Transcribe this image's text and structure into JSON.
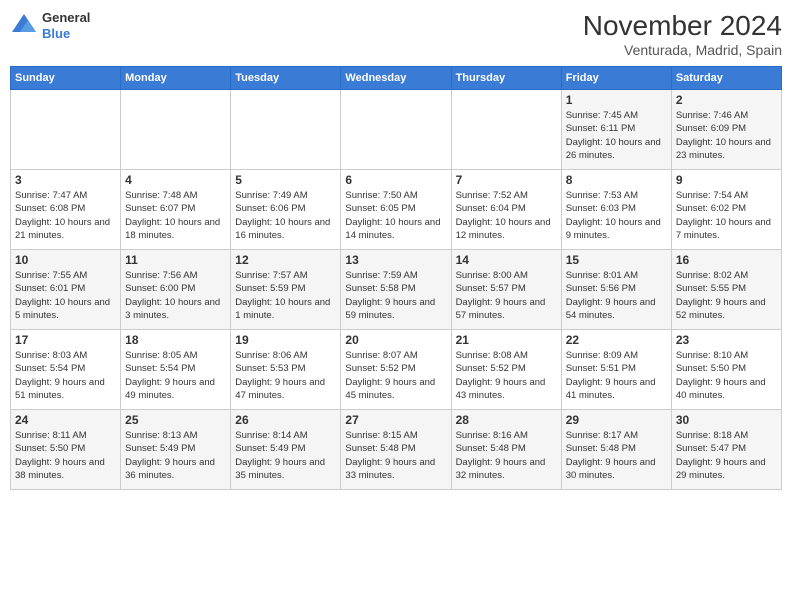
{
  "logo": {
    "general": "General",
    "blue": "Blue"
  },
  "title": "November 2024",
  "location": "Venturada, Madrid, Spain",
  "days_of_week": [
    "Sunday",
    "Monday",
    "Tuesday",
    "Wednesday",
    "Thursday",
    "Friday",
    "Saturday"
  ],
  "weeks": [
    [
      {
        "day": "",
        "info": ""
      },
      {
        "day": "",
        "info": ""
      },
      {
        "day": "",
        "info": ""
      },
      {
        "day": "",
        "info": ""
      },
      {
        "day": "",
        "info": ""
      },
      {
        "day": "1",
        "info": "Sunrise: 7:45 AM\nSunset: 6:11 PM\nDaylight: 10 hours and 26 minutes."
      },
      {
        "day": "2",
        "info": "Sunrise: 7:46 AM\nSunset: 6:09 PM\nDaylight: 10 hours and 23 minutes."
      }
    ],
    [
      {
        "day": "3",
        "info": "Sunrise: 7:47 AM\nSunset: 6:08 PM\nDaylight: 10 hours and 21 minutes."
      },
      {
        "day": "4",
        "info": "Sunrise: 7:48 AM\nSunset: 6:07 PM\nDaylight: 10 hours and 18 minutes."
      },
      {
        "day": "5",
        "info": "Sunrise: 7:49 AM\nSunset: 6:06 PM\nDaylight: 10 hours and 16 minutes."
      },
      {
        "day": "6",
        "info": "Sunrise: 7:50 AM\nSunset: 6:05 PM\nDaylight: 10 hours and 14 minutes."
      },
      {
        "day": "7",
        "info": "Sunrise: 7:52 AM\nSunset: 6:04 PM\nDaylight: 10 hours and 12 minutes."
      },
      {
        "day": "8",
        "info": "Sunrise: 7:53 AM\nSunset: 6:03 PM\nDaylight: 10 hours and 9 minutes."
      },
      {
        "day": "9",
        "info": "Sunrise: 7:54 AM\nSunset: 6:02 PM\nDaylight: 10 hours and 7 minutes."
      }
    ],
    [
      {
        "day": "10",
        "info": "Sunrise: 7:55 AM\nSunset: 6:01 PM\nDaylight: 10 hours and 5 minutes."
      },
      {
        "day": "11",
        "info": "Sunrise: 7:56 AM\nSunset: 6:00 PM\nDaylight: 10 hours and 3 minutes."
      },
      {
        "day": "12",
        "info": "Sunrise: 7:57 AM\nSunset: 5:59 PM\nDaylight: 10 hours and 1 minute."
      },
      {
        "day": "13",
        "info": "Sunrise: 7:59 AM\nSunset: 5:58 PM\nDaylight: 9 hours and 59 minutes."
      },
      {
        "day": "14",
        "info": "Sunrise: 8:00 AM\nSunset: 5:57 PM\nDaylight: 9 hours and 57 minutes."
      },
      {
        "day": "15",
        "info": "Sunrise: 8:01 AM\nSunset: 5:56 PM\nDaylight: 9 hours and 54 minutes."
      },
      {
        "day": "16",
        "info": "Sunrise: 8:02 AM\nSunset: 5:55 PM\nDaylight: 9 hours and 52 minutes."
      }
    ],
    [
      {
        "day": "17",
        "info": "Sunrise: 8:03 AM\nSunset: 5:54 PM\nDaylight: 9 hours and 51 minutes."
      },
      {
        "day": "18",
        "info": "Sunrise: 8:05 AM\nSunset: 5:54 PM\nDaylight: 9 hours and 49 minutes."
      },
      {
        "day": "19",
        "info": "Sunrise: 8:06 AM\nSunset: 5:53 PM\nDaylight: 9 hours and 47 minutes."
      },
      {
        "day": "20",
        "info": "Sunrise: 8:07 AM\nSunset: 5:52 PM\nDaylight: 9 hours and 45 minutes."
      },
      {
        "day": "21",
        "info": "Sunrise: 8:08 AM\nSunset: 5:52 PM\nDaylight: 9 hours and 43 minutes."
      },
      {
        "day": "22",
        "info": "Sunrise: 8:09 AM\nSunset: 5:51 PM\nDaylight: 9 hours and 41 minutes."
      },
      {
        "day": "23",
        "info": "Sunrise: 8:10 AM\nSunset: 5:50 PM\nDaylight: 9 hours and 40 minutes."
      }
    ],
    [
      {
        "day": "24",
        "info": "Sunrise: 8:11 AM\nSunset: 5:50 PM\nDaylight: 9 hours and 38 minutes."
      },
      {
        "day": "25",
        "info": "Sunrise: 8:13 AM\nSunset: 5:49 PM\nDaylight: 9 hours and 36 minutes."
      },
      {
        "day": "26",
        "info": "Sunrise: 8:14 AM\nSunset: 5:49 PM\nDaylight: 9 hours and 35 minutes."
      },
      {
        "day": "27",
        "info": "Sunrise: 8:15 AM\nSunset: 5:48 PM\nDaylight: 9 hours and 33 minutes."
      },
      {
        "day": "28",
        "info": "Sunrise: 8:16 AM\nSunset: 5:48 PM\nDaylight: 9 hours and 32 minutes."
      },
      {
        "day": "29",
        "info": "Sunrise: 8:17 AM\nSunset: 5:48 PM\nDaylight: 9 hours and 30 minutes."
      },
      {
        "day": "30",
        "info": "Sunrise: 8:18 AM\nSunset: 5:47 PM\nDaylight: 9 hours and 29 minutes."
      }
    ]
  ]
}
